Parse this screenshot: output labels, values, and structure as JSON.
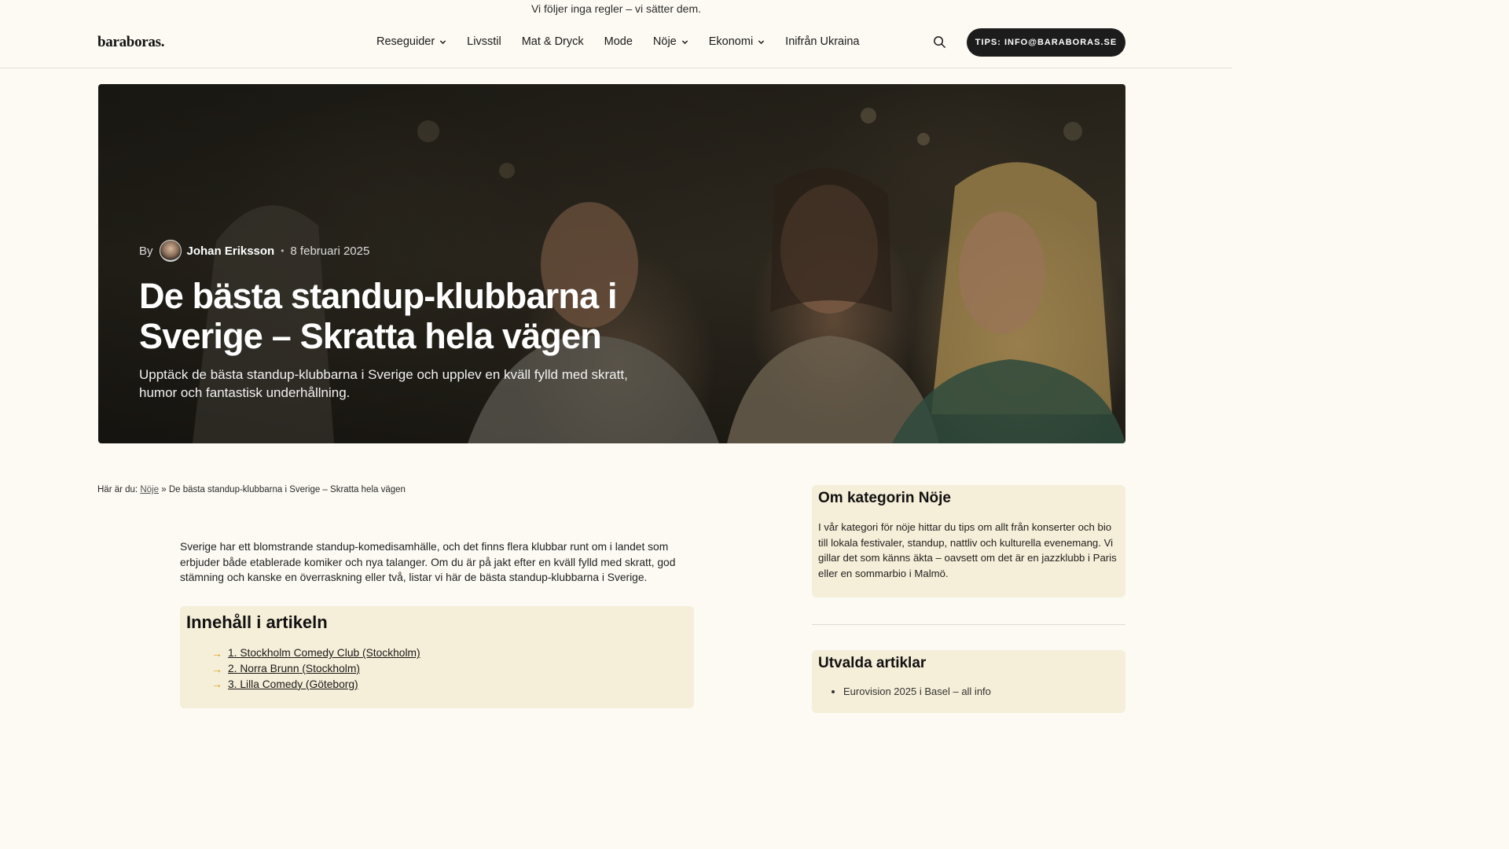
{
  "topline": "Vi följer inga regler – vi sätter dem.",
  "header": {
    "logo": "baraboras.",
    "nav": [
      {
        "label": "Reseguider",
        "has_dropdown": true
      },
      {
        "label": "Livsstil",
        "has_dropdown": false
      },
      {
        "label": "Mat & Dryck",
        "has_dropdown": false
      },
      {
        "label": "Mode",
        "has_dropdown": false
      },
      {
        "label": "Nöje",
        "has_dropdown": true
      },
      {
        "label": "Ekonomi",
        "has_dropdown": true
      },
      {
        "label": "Inifrån Ukraina",
        "has_dropdown": false
      }
    ],
    "search_icon": "search-icon",
    "tips_label": "TIPS: INFO@BARABORAS.SE"
  },
  "hero": {
    "by_label": "By",
    "author": "Johan Eriksson",
    "separator": "•",
    "date": "8 februari 2025",
    "title": "De bästa standup-klubbarna i Sverige – Skratta hela vägen",
    "subtitle": "Upptäck de bästa standup-klubbarna i Sverige och upplev en kväll fylld med skratt, humor och fantastisk underhållning."
  },
  "breadcrumb": {
    "prefix": "Här är du:",
    "category": "Nöje",
    "sep": "»",
    "current": "De bästa standup-klubbarna i Sverige – Skratta hela vägen"
  },
  "intro": "Sverige har ett blomstrande standup-komedisamhälle, och det finns flera klubbar runt om i landet som erbjuder både etablerade komiker och nya talanger. Om du är på jakt efter en kväll fylld med skratt, god stämning och kanske en överraskning eller två, listar vi här de bästa standup-klubbarna i Sverige.",
  "toc": {
    "title": "Innehåll i artikeln",
    "arrow": "→",
    "items": [
      "1. Stockholm Comedy Club (Stockholm)",
      "2. Norra Brunn (Stockholm)",
      "3. Lilla Comedy (Göteborg)"
    ]
  },
  "sidebar": {
    "about_title": "Om kategorin Nöje",
    "about_text": "I vår kategori för nöje hittar du tips om allt från konserter och bio till lokala festivaler, standup, nattliv och kulturella evenemang. Vi gillar det som känns äkta – oavsett om det är en jazzklubb i Paris eller en sommarbio i Malmö.",
    "featured_title": "Utvalda artiklar",
    "featured_items": [
      "Eurovision 2025 i Basel – all info"
    ]
  },
  "colors": {
    "page_bg": "#fcfaf3",
    "box_bg": "#f5eed8",
    "button_bg": "#1c1c1c",
    "arrow_accent": "#e0a020"
  }
}
